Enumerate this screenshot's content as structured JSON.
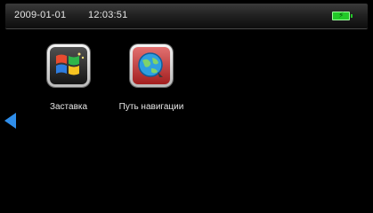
{
  "status": {
    "date": "2009-01-01",
    "time": "12:03:51",
    "battery_icon": "battery-charging-icon"
  },
  "apps": [
    {
      "label": "Заставка",
      "icon": "windows-logo-icon"
    },
    {
      "label": "Путь навигации",
      "icon": "globe-navigation-icon"
    }
  ],
  "nav": {
    "left_arrow_icon": "left-arrow-icon"
  },
  "colors": {
    "background": "#000000",
    "battery": "#22c928",
    "arrow": "#2f8eea"
  }
}
